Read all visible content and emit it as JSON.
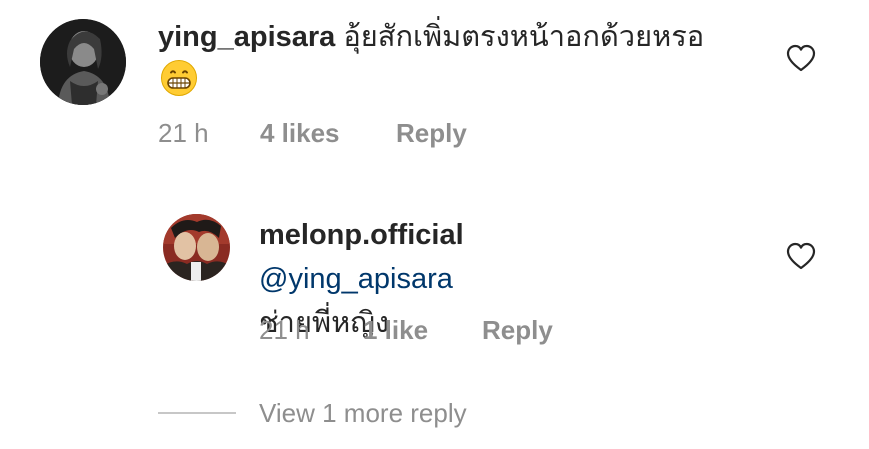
{
  "comments": [
    {
      "username": "ying_apisara",
      "text": "อุ้ยสักเพิ่มตรงหน้าอกด้วยหรอ",
      "emoji": "grinning-face-icon",
      "timestamp": "21 h",
      "likes": "4 likes",
      "reply_label": "Reply"
    }
  ],
  "replies": [
    {
      "username": "melonp.official",
      "mention": "@ying_apisara",
      "text": "ช่ายพี่หญิง",
      "timestamp": "21 h",
      "likes": "1 like",
      "reply_label": "Reply"
    }
  ],
  "view_more_label": "View 1 more reply",
  "colors": {
    "text": "#262626",
    "secondary": "#8e8e8e",
    "mention": "#00376b",
    "divider": "#c7c7c7"
  }
}
